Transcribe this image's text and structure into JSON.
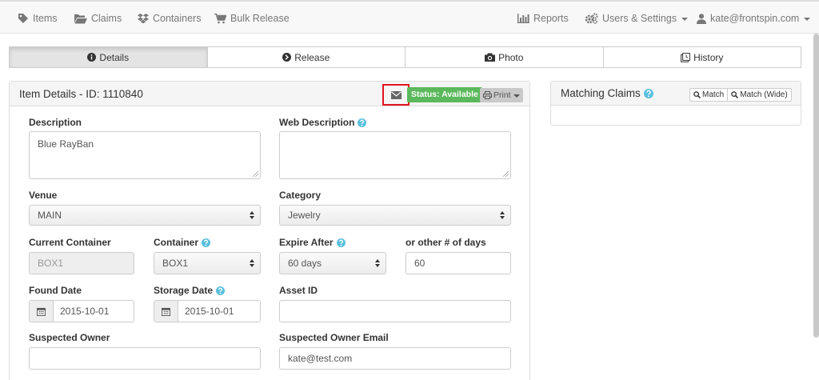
{
  "nav": {
    "left": [
      {
        "label": "Items",
        "icon": "tag-icon"
      },
      {
        "label": "Claims",
        "icon": "folder-open-icon"
      },
      {
        "label": "Containers",
        "icon": "dropbox-icon"
      },
      {
        "label": "Bulk Release",
        "icon": "cart-icon"
      }
    ],
    "reports": "Reports",
    "settings": "Users & Settings",
    "user": "kate@frontspin.com"
  },
  "tabs": [
    {
      "label": "Details",
      "icon": "info-circle-icon",
      "active": true
    },
    {
      "label": "Release",
      "icon": "arrow-circle-right-icon"
    },
    {
      "label": "Photo",
      "icon": "camera-icon"
    },
    {
      "label": "History",
      "icon": "history-icon"
    }
  ],
  "item": {
    "title": "Item Details - ID: 1110840",
    "status": "Status: Available",
    "print": "Print",
    "colors": {
      "status": "#5cb85c",
      "highlight": "#e0141e",
      "help": "#5bc0de"
    },
    "fields": {
      "description": {
        "label": "Description",
        "value": "Blue RayBan"
      },
      "web_description": {
        "label": "Web Description",
        "value": ""
      },
      "venue": {
        "label": "Venue",
        "value": "MAIN"
      },
      "category": {
        "label": "Category",
        "value": "Jewelry"
      },
      "current_container": {
        "label": "Current Container",
        "value": "BOX1"
      },
      "container": {
        "label": "Container",
        "value": "BOX1"
      },
      "expire_after": {
        "label": "Expire After",
        "value": "60 days"
      },
      "other_days": {
        "label": "or other # of days",
        "value": "60"
      },
      "found_date": {
        "label": "Found Date",
        "value": "2015-10-01"
      },
      "storage_date": {
        "label": "Storage Date",
        "value": "2015-10-01"
      },
      "asset_id": {
        "label": "Asset ID",
        "value": ""
      },
      "suspected_owner": {
        "label": "Suspected Owner",
        "value": ""
      },
      "suspected_owner_email": {
        "label": "Suspected Owner Email",
        "value": "kate@test.com"
      }
    }
  },
  "claims": {
    "title": "Matching Claims",
    "match": "Match",
    "match_wide": "Match (Wide)"
  }
}
